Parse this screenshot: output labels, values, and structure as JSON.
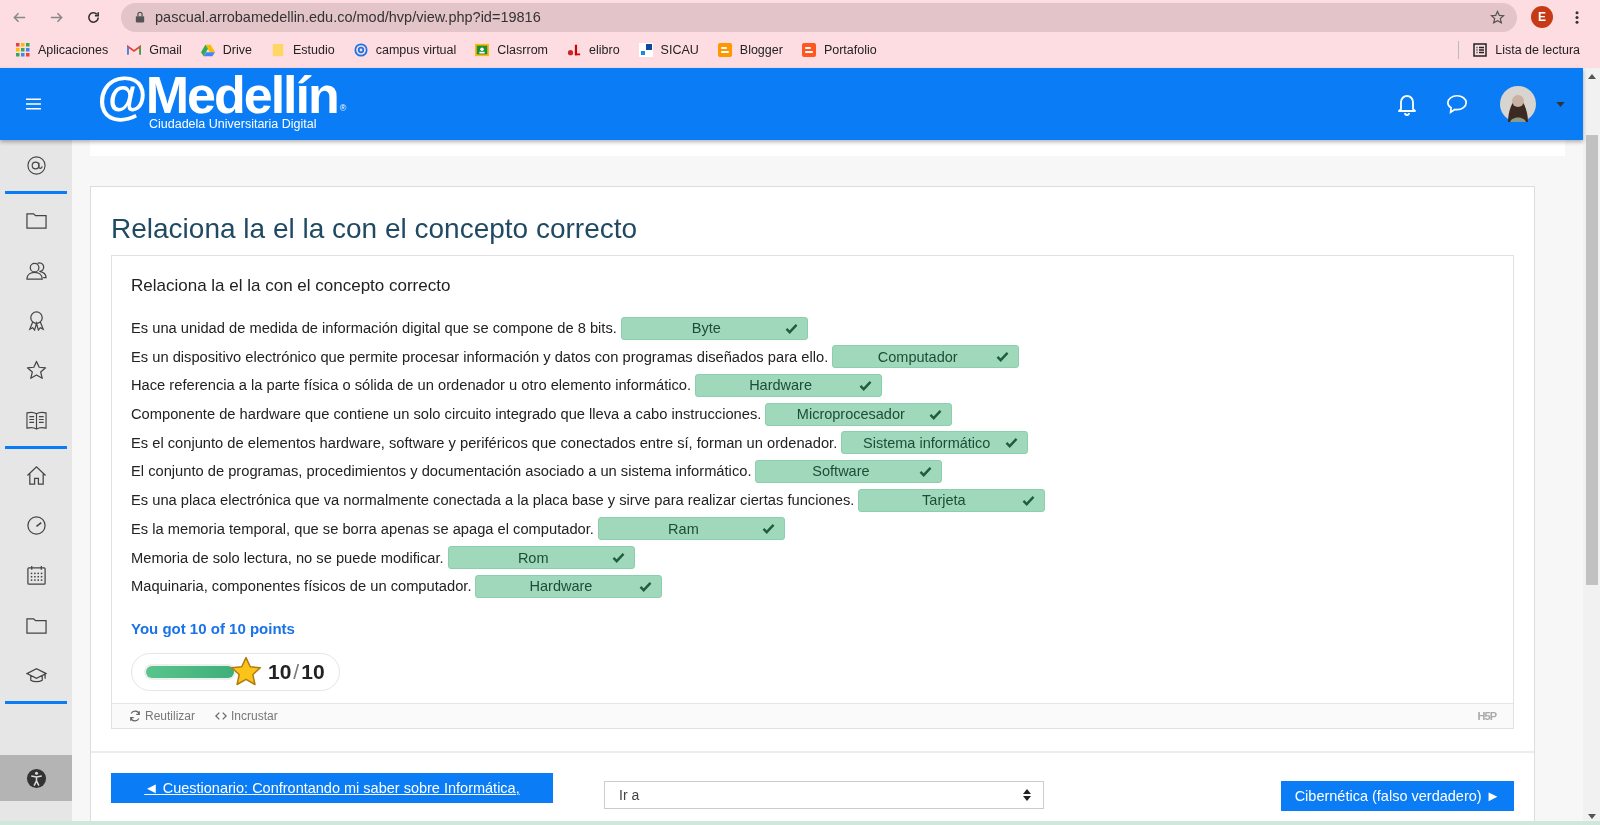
{
  "browser": {
    "url": "pascual.arrobamedellin.edu.co/mod/hvp/view.php?id=19816",
    "profile_initial": "E",
    "bookmarks": [
      {
        "label": "Aplicaciones",
        "kind": "apps"
      },
      {
        "label": "Gmail",
        "kind": "mail"
      },
      {
        "label": "Drive",
        "kind": "drive"
      },
      {
        "label": "Estudio",
        "kind": "folder"
      },
      {
        "label": "campus virtual",
        "kind": "at"
      },
      {
        "label": "Clasrrom",
        "kind": "classroom"
      },
      {
        "label": "elibro",
        "kind": "elibro"
      },
      {
        "label": "SICAU",
        "kind": "sicau"
      },
      {
        "label": "Blogger",
        "kind": "blogger"
      },
      {
        "label": "Portafolio",
        "kind": "blogger"
      }
    ],
    "reading_list": "Lista de lectura"
  },
  "header": {
    "logo": "@Medellín",
    "logo_mark": "®",
    "logo_subtitle": "Ciudadela Universitaria Digital"
  },
  "page_title": "Relaciona la el la con el concepto correcto",
  "activity": {
    "task": "Relaciona la el la con el concepto correcto",
    "items": [
      {
        "prompt": "Es una unidad de medida de información digital que se compone de 8 bits.",
        "answer": "Byte",
        "correct": true
      },
      {
        "prompt": "Es un dispositivo electrónico que permite procesar información y datos con programas diseñados para ello.",
        "answer": "Computador",
        "correct": true
      },
      {
        "prompt": "Hace referencia a la parte física o sólida de un ordenador u otro elemento informático.",
        "answer": "Hardware",
        "correct": true
      },
      {
        "prompt": "Componente de hardware que contiene un solo circuito integrado que lleva a cabo instrucciones.",
        "answer": "Microprocesador",
        "correct": true
      },
      {
        "prompt": "Es el conjunto de elementos hardware, software y periféricos que conectados entre sí, forman un ordenador.",
        "answer": "Sistema informático",
        "correct": true
      },
      {
        "prompt": "El conjunto de programas, procedimientos y documentación asociado a un sistema informático.",
        "answer": "Software",
        "correct": true
      },
      {
        "prompt": "Es una placa electrónica que va normalmente conectada a la placa base y sirve para realizar ciertas funciones.",
        "answer": "Tarjeta",
        "correct": true
      },
      {
        "prompt": "Es la memoria temporal, que se borra apenas se apaga el computador.",
        "answer": "Ram",
        "correct": true
      },
      {
        "prompt": "Memoria de solo lectura, no se puede modificar.",
        "answer": "Rom",
        "correct": true
      },
      {
        "prompt": "Maquinaria, componentes físicos de un computador.",
        "answer": "Hardware",
        "correct": true
      }
    ],
    "feedback": "You got 10 of 10 points",
    "score": {
      "level": 1,
      "value": "10",
      "separator": "/",
      "max": "10"
    },
    "actions": [
      "Reutilizar",
      "Incrustar"
    ],
    "brand": "H5P"
  },
  "navigation": {
    "previous": "◄ Cuestionario: Confrontando mi saber sobre Informática,",
    "jump_placeholder": "Ir a",
    "next": "Cibernética (falso verdadero) ►"
  }
}
